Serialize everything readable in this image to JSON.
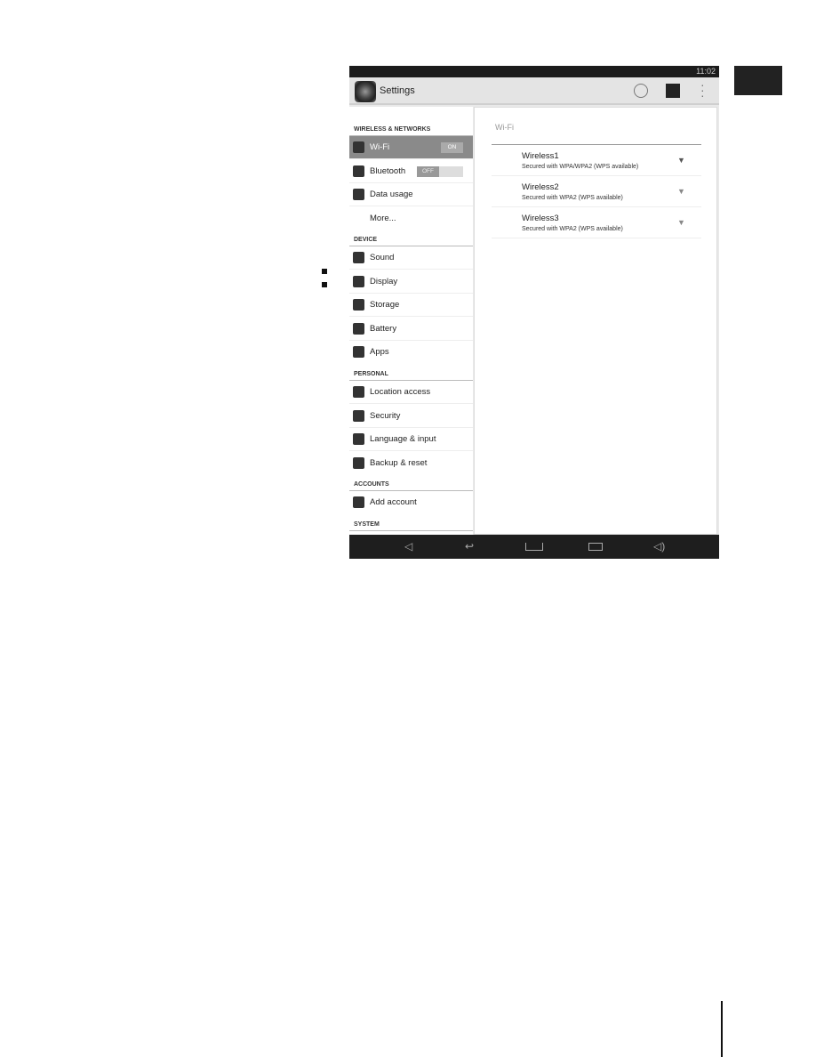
{
  "status": {
    "time": "11:02"
  },
  "actionbar": {
    "title": "Settings"
  },
  "sidebar": {
    "sections": [
      {
        "label": "WIRELESS & NETWORKS"
      },
      {
        "label": "DEVICE"
      },
      {
        "label": "PERSONAL"
      },
      {
        "label": "ACCOUNTS"
      },
      {
        "label": "SYSTEM"
      }
    ],
    "items": [
      {
        "label": "Wi-Fi",
        "toggle": "ON"
      },
      {
        "label": "Bluetooth",
        "toggle": "OFF"
      },
      {
        "label": "Data usage"
      },
      {
        "label": "More..."
      },
      {
        "label": "Sound"
      },
      {
        "label": "Display"
      },
      {
        "label": "Storage"
      },
      {
        "label": "Battery"
      },
      {
        "label": "Apps"
      },
      {
        "label": "Location access"
      },
      {
        "label": "Security"
      },
      {
        "label": "Language & input"
      },
      {
        "label": "Backup & reset"
      },
      {
        "label": "Add account"
      }
    ]
  },
  "wifi": {
    "title": "Wi-Fi",
    "networks": [
      {
        "name": "Wireless1",
        "security": "Secured with WPA/WPA2 (WPS available)"
      },
      {
        "name": "Wireless2",
        "security": "Secured with WPA2 (WPS available)"
      },
      {
        "name": "Wireless3",
        "security": "Secured with WPA2 (WPS available)"
      }
    ]
  }
}
